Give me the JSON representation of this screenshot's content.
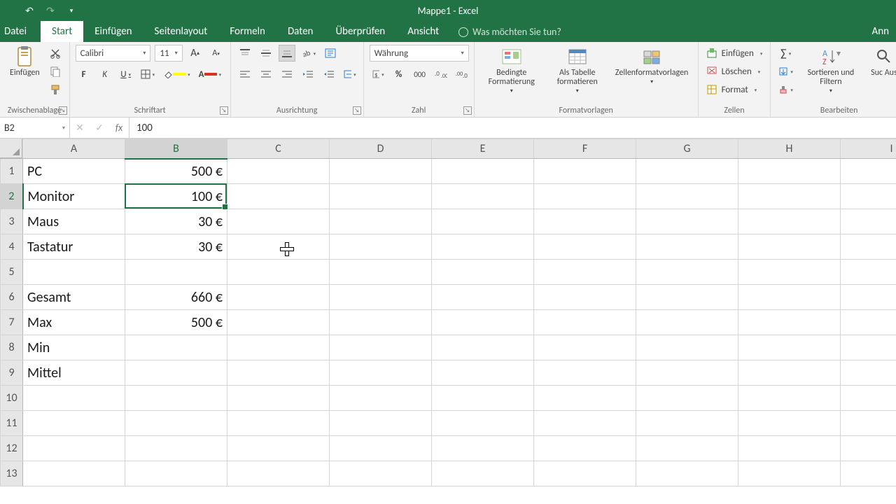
{
  "app": {
    "title": "Mappe1 - Excel"
  },
  "qat": {
    "undo": "↶",
    "redo": "↷",
    "customize": "▾"
  },
  "tabs": {
    "file": "Datei",
    "home": "Start",
    "insert": "Einfügen",
    "pagelayout": "Seitenlayout",
    "formulas": "Formeln",
    "data": "Daten",
    "review": "Überprüfen",
    "view": "Ansicht",
    "tellme": "Was möchten Sie tun?",
    "signin": "Ann"
  },
  "ribbon": {
    "clipboard": {
      "paste": "Einfügen",
      "group": "Zwischenablage"
    },
    "font": {
      "name": "Calibri",
      "size": "11",
      "bold": "F",
      "italic": "K",
      "underline": "U",
      "group": "Schriftart"
    },
    "alignment": {
      "group": "Ausrichtung"
    },
    "number": {
      "format": "Währung",
      "group": "Zahl"
    },
    "styles": {
      "cond": "Bedingte Formatierung",
      "table": "Als Tabelle formatieren",
      "cell": "Zellenformatvorlagen",
      "group": "Formatvorlagen"
    },
    "cells": {
      "insert": "Einfügen",
      "delete": "Löschen",
      "format": "Format",
      "group": "Zellen"
    },
    "editing": {
      "sortfilter": "Sortieren und Filtern",
      "find": "Suc Aus",
      "group": "Bearbeiten"
    }
  },
  "fx": {
    "namebox": "B2",
    "value": "100"
  },
  "columns": [
    "A",
    "B",
    "C",
    "D",
    "E",
    "F",
    "G",
    "H",
    "I"
  ],
  "selected_col_index": 1,
  "selected_row_index": 1,
  "cells": {
    "A1": "PC",
    "B1": "500 €",
    "A2": "Monitor",
    "B2": "100 €",
    "A3": "Maus",
    "B3": "30 €",
    "A4": "Tastatur",
    "B4": "30 €",
    "A6": "Gesamt",
    "B6": "660 €",
    "A7": "Max",
    "B7": "500 €",
    "A8": "Min",
    "A9": "Mittel"
  },
  "chart_data": {
    "type": "table",
    "rows": [
      {
        "label": "PC",
        "value_eur": 500
      },
      {
        "label": "Monitor",
        "value_eur": 100
      },
      {
        "label": "Maus",
        "value_eur": 30
      },
      {
        "label": "Tastatur",
        "value_eur": 30
      },
      {
        "label": "Gesamt",
        "value_eur": 660
      },
      {
        "label": "Max",
        "value_eur": 500
      },
      {
        "label": "Min",
        "value_eur": null
      },
      {
        "label": "Mittel",
        "value_eur": null
      }
    ],
    "currency": "€"
  }
}
